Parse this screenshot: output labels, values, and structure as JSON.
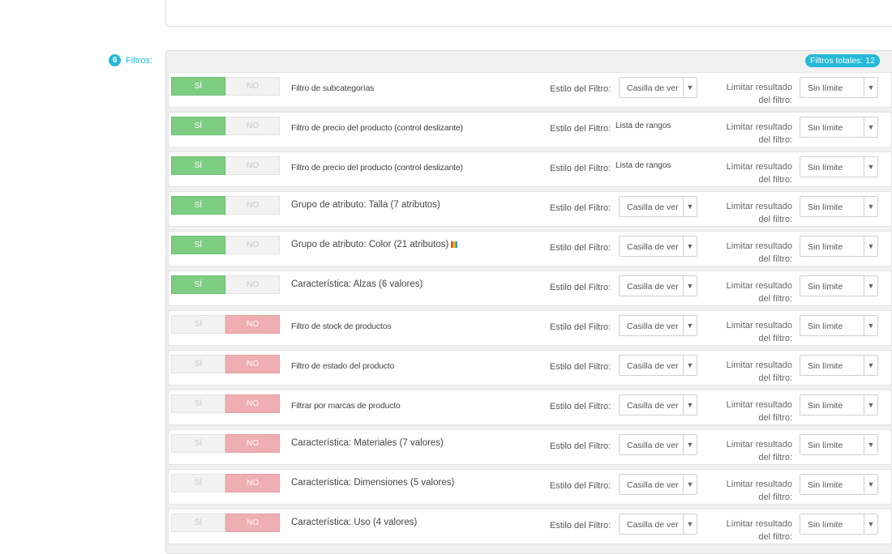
{
  "step": {
    "number": "6",
    "label": "Filtros:"
  },
  "total_badge": "Filtros totales: 12",
  "labels": {
    "yes": "SÍ",
    "no": "NO",
    "filter_style": "Estilo del Filtro:",
    "limit": "Limitar resultado del filtro:"
  },
  "filters": [
    {
      "name": "Filtro de subcategorías",
      "enabled": true,
      "style": "Casilla de ver",
      "limit": "Sin límite"
    },
    {
      "name": "Filtro de precio del producto (control deslizante)",
      "enabled": true,
      "style_static": "Lista de rangos",
      "limit": "Sin límite"
    },
    {
      "name": "Filtro de precio del producto (control deslizante)",
      "enabled": true,
      "style_static": "Lista de rangos",
      "limit": "Sin límite"
    },
    {
      "name": "Grupo de atributo: Talla (7 atributos)",
      "enabled": true,
      "style": "Casilla de ver",
      "limit": "Sin límite"
    },
    {
      "name": "Grupo de atributo: Color (21 atributos)",
      "enabled": true,
      "style": "Casilla de ver",
      "limit": "Sin límite",
      "icon": "color-palette-icon"
    },
    {
      "name": "Característica: Alzas (6 valores)",
      "enabled": true,
      "style": "Casilla de ver",
      "limit": "Sin límite"
    },
    {
      "name": "Filtro de stock de productos",
      "enabled": false,
      "style": "Casilla de ver",
      "limit": "Sin límite"
    },
    {
      "name": "Filtro de estado del producto",
      "enabled": false,
      "style": "Casilla de ver",
      "limit": "Sin límite"
    },
    {
      "name": "Filtrar por marcas de producto",
      "enabled": false,
      "style": "Casilla de ver",
      "limit": "Sin límite"
    },
    {
      "name": "Característica: Materiales (7 valores)",
      "enabled": false,
      "style": "Casilla de ver",
      "limit": "Sin límite"
    },
    {
      "name": "Característica: Dimensiones (5 valores)",
      "enabled": false,
      "style": "Casilla de ver",
      "limit": "Sin límite"
    },
    {
      "name": "Característica: Uso (4 valores)",
      "enabled": false,
      "style": "Casilla de ver",
      "limit": "Sin límite"
    }
  ],
  "colors": {
    "accent": "#25b9d7",
    "yes": "#7dcd83",
    "no": "#eeaeb2"
  }
}
